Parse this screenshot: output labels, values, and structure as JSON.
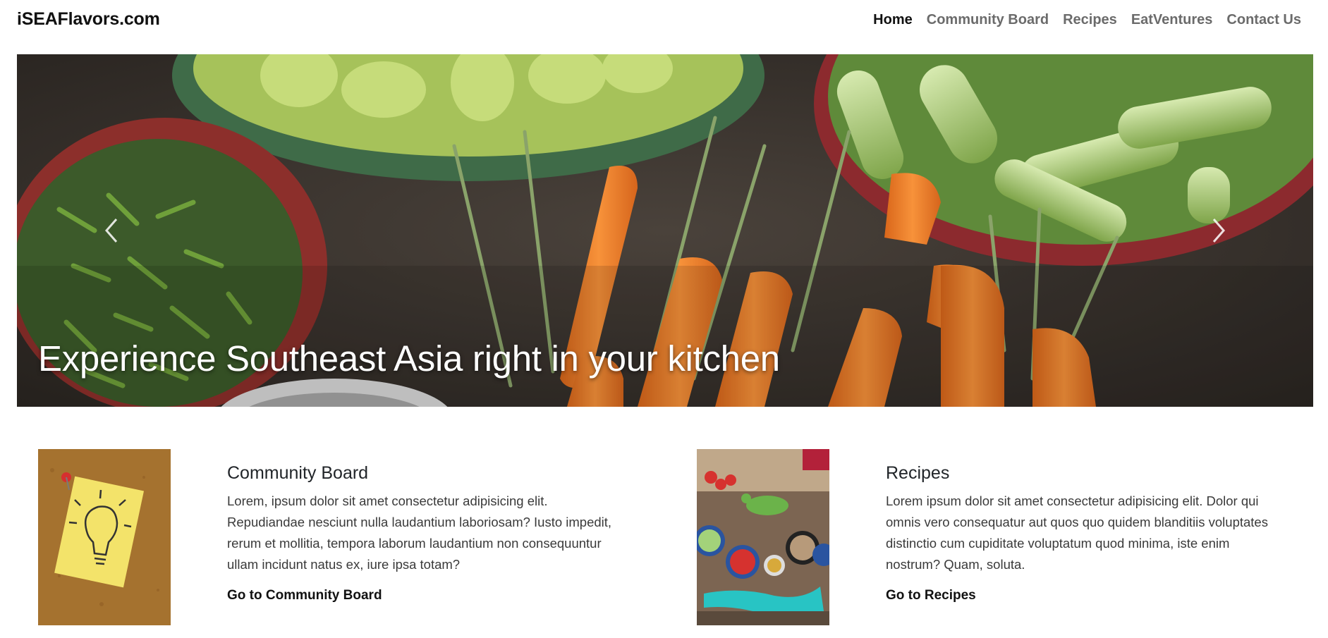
{
  "brand": "iSEAFlavors.com",
  "nav": {
    "home": "Home",
    "community": "Community Board",
    "recipes": "Recipes",
    "eatventures": "EatVentures",
    "contact": "Contact Us"
  },
  "carousel": {
    "caption": "Experience Southeast Asia right in your kitchen",
    "prev_icon": "chevron-left-icon",
    "next_icon": "chevron-right-icon"
  },
  "cards": [
    {
      "title": "Community Board",
      "text": "Lorem, ipsum dolor sit amet consectetur adipisicing elit. Repudiandae nesciunt nulla laudantium laboriosam? Iusto impedit, rerum et mollitia, tempora laborum laudantium non consequuntur ullam incidunt natus ex, iure ipsa totam?",
      "link": "Go to Community Board"
    },
    {
      "title": "Recipes",
      "text": "Lorem ipsum dolor sit amet consectetur adipisicing elit. Dolor qui omnis vero consequatur aut quos quo quidem blanditiis voluptates distinctio cum cupiditate voluptatum quod minima, iste enim nostrum? Quam, soluta.",
      "link": "Go to Recipes"
    }
  ],
  "colors": {
    "text": "#212529",
    "nav_inactive": "#6b6b6b",
    "nav_active": "#111111"
  }
}
